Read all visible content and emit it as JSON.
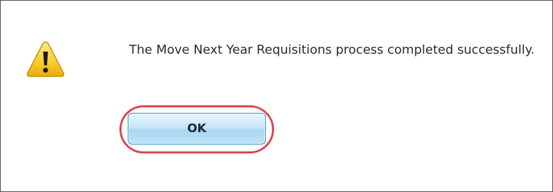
{
  "dialog": {
    "icon": "warning-icon",
    "message": "The Move Next Year Requisitions process completed successfully.",
    "ok_label": "OK"
  },
  "colors": {
    "highlight": "#d9474e",
    "button_border": "#3c8fc2",
    "warning_fill": "#f5c518"
  }
}
